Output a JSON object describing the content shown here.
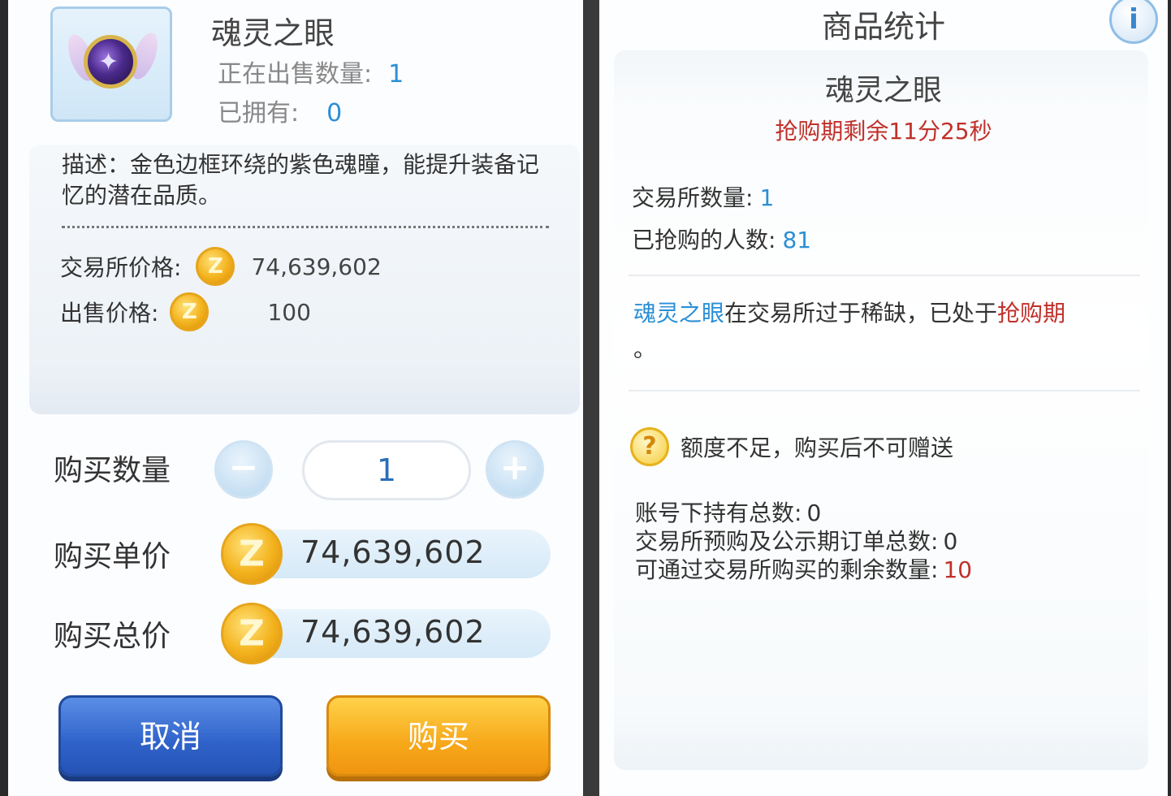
{
  "item": {
    "name": "魂灵之眼",
    "on_sale_label": "正在出售数量:",
    "on_sale_value": "1",
    "owned_label": "已拥有:",
    "owned_value": "0",
    "icon": "soul-eye-orb-icon",
    "description": "描述：金色边框环绕的紫色魂瞳，能提升装备记忆的潜在品质。",
    "exchange_price_label": "交易所价格:",
    "exchange_price": "74,639,602",
    "sell_price_label": "出售价格:",
    "sell_price": "100"
  },
  "purchase": {
    "quantity_label": "购买数量",
    "quantity_value": "1",
    "minus_symbol": "−",
    "plus_symbol": "+",
    "unit_price_label": "购买单价",
    "unit_price": "74,639,602",
    "total_price_label": "购买总价",
    "total_price": "74,639,602",
    "coin_symbol": "Z",
    "cancel_label": "取消",
    "buy_label": "购买"
  },
  "stats": {
    "title": "商品统计",
    "info_symbol": "i",
    "item_name": "魂灵之眼",
    "timer": "抢购期剩余11分25秒",
    "exchange_qty_label": "交易所数量:",
    "exchange_qty": "1",
    "buyers_label": "已抢购的人数:",
    "buyers": "81",
    "notice_item": "魂灵之眼",
    "notice_mid": "在交易所过于稀缺，已处于",
    "notice_period": "抢购期",
    "notice_end": "。",
    "warn_symbol": "?",
    "warn_text": "额度不足，购买后不可赠送",
    "account_total_label": "账号下持有总数:",
    "account_total": "0",
    "preorder_label": "交易所预购及公示期订单总数:",
    "preorder": "0",
    "remaining_label": "可通过交易所购买的剩余数量:",
    "remaining": "10"
  },
  "colors": {
    "accent_blue": "#2a8fd6",
    "alert_red": "#c0302a",
    "coin_gold": "#f3b21c",
    "cancel_blue": "#2f62c9",
    "buy_orange": "#f7a81a"
  }
}
